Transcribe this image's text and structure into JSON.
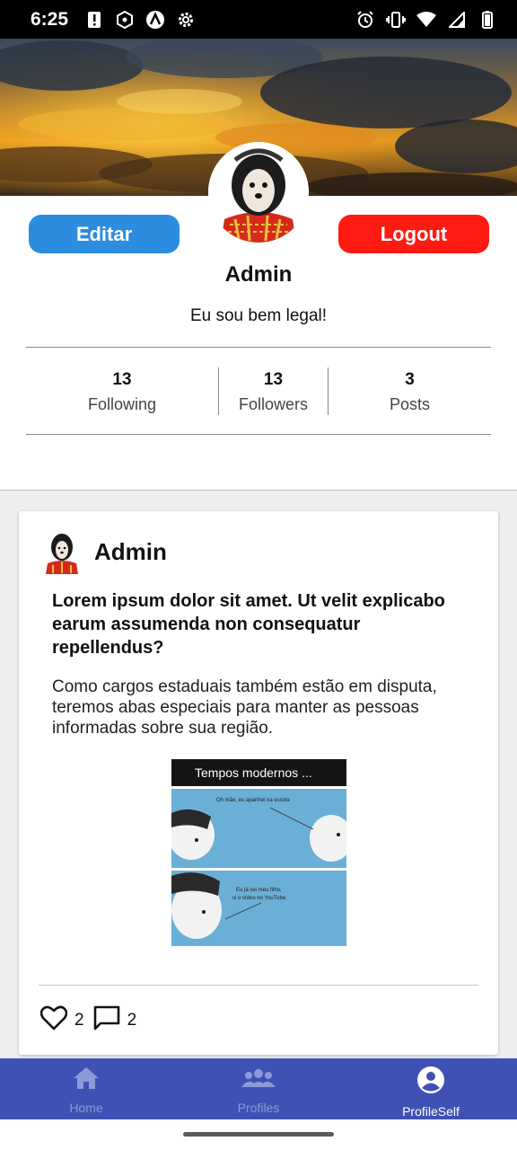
{
  "status_bar": {
    "time": "6:25",
    "left_icons": [
      "alert-icon",
      "hexagon-icon",
      "app-logo-icon",
      "settings-icon"
    ],
    "right_icons": [
      "alarm-icon",
      "vibrate-icon",
      "wifi-icon",
      "signal-icon",
      "battery-icon"
    ]
  },
  "profile": {
    "edit_label": "Editar",
    "logout_label": "Logout",
    "name": "Admin",
    "bio": "Eu sou bem legal!",
    "stats": [
      {
        "value": "13",
        "label": "Following"
      },
      {
        "value": "13",
        "label": "Followers"
      },
      {
        "value": "3",
        "label": "Posts"
      }
    ]
  },
  "post": {
    "author": "Admin",
    "title": "Lorem ipsum dolor sit amet. Ut velit explicabo earum assumenda non consequatur repellendus?",
    "body": "Como cargos estaduais também estão em disputa, teremos abas especiais para manter as pessoas informadas sobre sua região.",
    "image": {
      "caption": "Tempos modernos ...",
      "bubble1": "Oh mãe, eu apanhei na escola",
      "bubble2a": "Eu já sei meu filho,",
      "bubble2b": "vi o vídeo no YouTube."
    },
    "likes": "2",
    "comments": "2"
  },
  "nav": {
    "items": [
      {
        "label": "Home",
        "icon": "home-icon",
        "active": false
      },
      {
        "label": "Profiles",
        "icon": "people-icon",
        "active": false
      },
      {
        "label": "ProfileSelf",
        "icon": "account-circle-icon",
        "active": true
      }
    ]
  },
  "colors": {
    "edit_button": "#2b8ce0",
    "logout_button": "#ff1a12",
    "nav_background": "#3f51b5",
    "nav_inactive": "#8e99d8"
  }
}
